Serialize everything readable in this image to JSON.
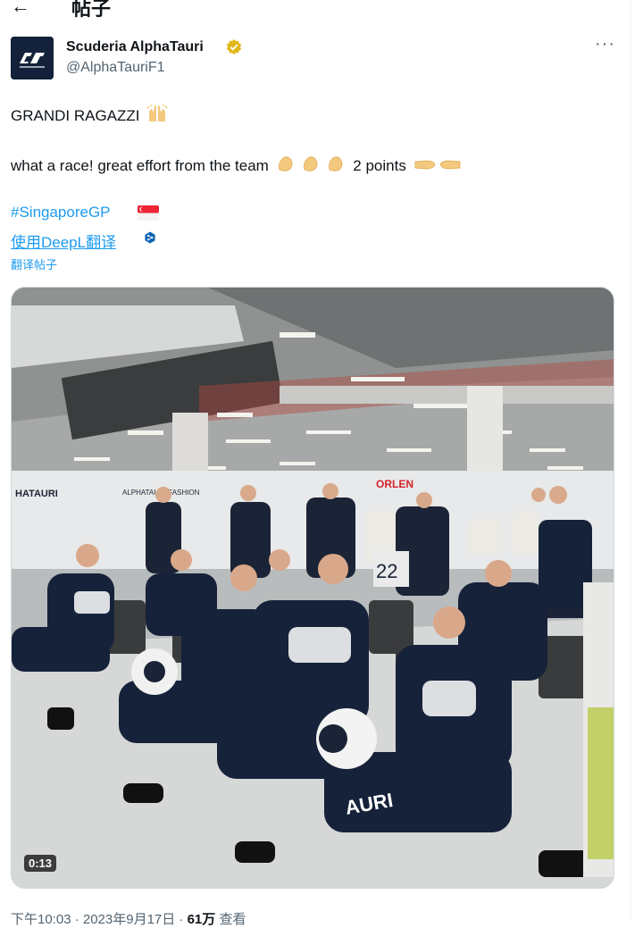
{
  "header": {
    "back_icon": "←",
    "title": "帖子"
  },
  "tweet": {
    "display_name": "Scuderia AlphaTauri",
    "handle": "@AlphaTauriF1",
    "line1": "GRANDI RAGAZZI",
    "line2": "what a race! great effort from the team",
    "line2_suffix": "2 points",
    "hashtag": "#SingaporeGP",
    "deepl_label": "使用DeepL翻译",
    "translate_label": "翻译帖子",
    "more_icon": "···",
    "video_duration": "0:13",
    "timestamp": "下午10:03 · 2023年9月17日 · ",
    "views_count": "61万",
    "views_label": "查看"
  },
  "video_signage": {
    "wall_left": "HATAURI",
    "wall_center": "ALPHATAURI FASHION",
    "sponsor": "ORLEN",
    "car_number": "22",
    "shirt_text": "AURI"
  },
  "colors": {
    "link": "#1d9bf0",
    "verified": "#e2b719",
    "team_navy": "#13223a"
  },
  "icons": {
    "back": "arrow-left-icon",
    "verified": "gold-verified-badge-icon",
    "more": "ellipsis-icon",
    "flag": "singapore-flag-icon",
    "deepl": "deepl-logo-icon"
  }
}
